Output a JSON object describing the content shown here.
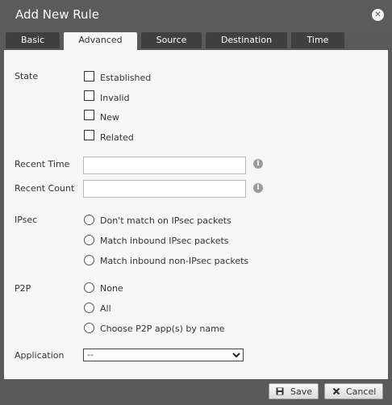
{
  "dialog": {
    "title": "Add New Rule",
    "close_icon": "close-icon"
  },
  "tabs": [
    {
      "label": "Basic",
      "active": false
    },
    {
      "label": "Advanced",
      "active": true
    },
    {
      "label": "Source",
      "active": false
    },
    {
      "label": "Destination",
      "active": false
    },
    {
      "label": "Time",
      "active": false
    }
  ],
  "state": {
    "label": "State",
    "options": [
      "Established",
      "Invalid",
      "New",
      "Related"
    ]
  },
  "recent_time": {
    "label": "Recent Time",
    "value": ""
  },
  "recent_count": {
    "label": "Recent Count",
    "value": ""
  },
  "ipsec": {
    "label": "IPsec",
    "options": [
      "Don't match on IPsec packets",
      "Match inbound IPsec packets",
      "Match inbound non-IPsec packets"
    ]
  },
  "p2p": {
    "label": "P2P",
    "options": [
      "None",
      "All",
      "Choose P2P app(s) by name"
    ]
  },
  "application": {
    "label": "Application",
    "value": "--"
  },
  "footer": {
    "save_label": "Save",
    "cancel_label": "Cancel"
  },
  "colors": {
    "title_bar": "#5b5b5b",
    "tab_inactive": "#404040",
    "panel": "#f7f7f7"
  }
}
